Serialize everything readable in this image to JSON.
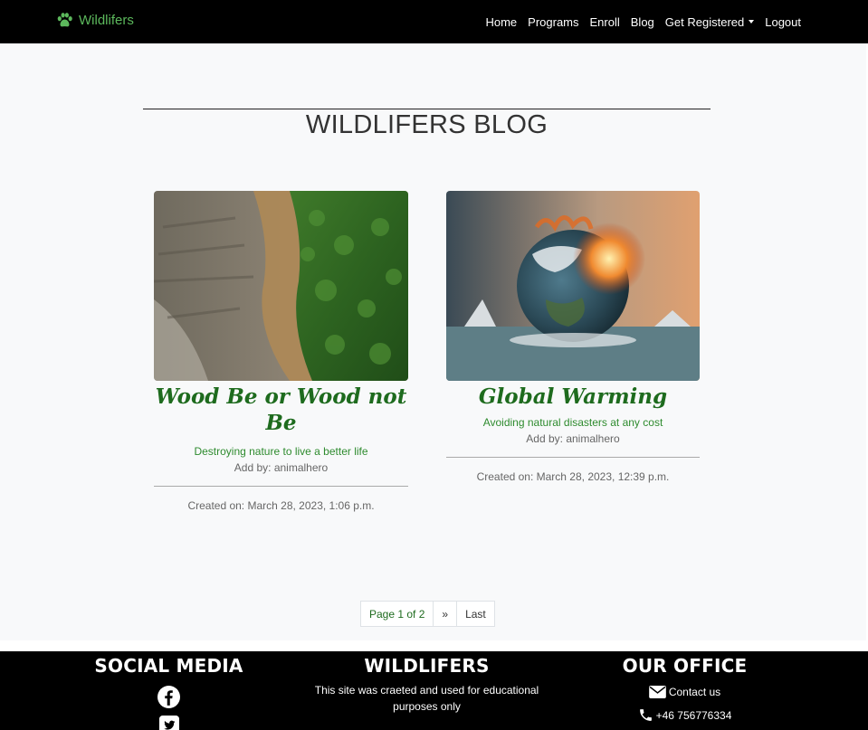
{
  "navbar": {
    "brand": "Wildlifers",
    "links": [
      "Home",
      "Programs",
      "Enroll",
      "Blog",
      "Get Registered",
      "Logout"
    ]
  },
  "page": {
    "title": "WILDLIFERS BLOG"
  },
  "posts": [
    {
      "title": "Wood Be or Wood not Be",
      "excerpt": "Destroying nature to live a better life",
      "author": "Add by: animalhero",
      "created": "Created on: March 28, 2023, 1:06 p.m."
    },
    {
      "title": "Global Warming",
      "excerpt": "Avoiding natural disasters at any cost",
      "author": "Add by: animalhero",
      "created": "Created on: March 28, 2023, 12:39 p.m."
    }
  ],
  "pagination": {
    "current": "Page 1 of 2",
    "next": "»",
    "last": "Last"
  },
  "footer": {
    "social_heading": "SOCIAL MEDIA",
    "brand_heading": "WILDLIFERS",
    "brand_text": "This site was craeted and used for educational purposes only",
    "office_heading": "OUR OFFICE",
    "contact_label": "Contact us",
    "phone": "+46 756776334"
  },
  "colors": {
    "accent_green": "#1e6b1e",
    "brand_green": "#5cb85c",
    "navbar_bg": "#000000",
    "main_bg": "#f8f9fa"
  }
}
